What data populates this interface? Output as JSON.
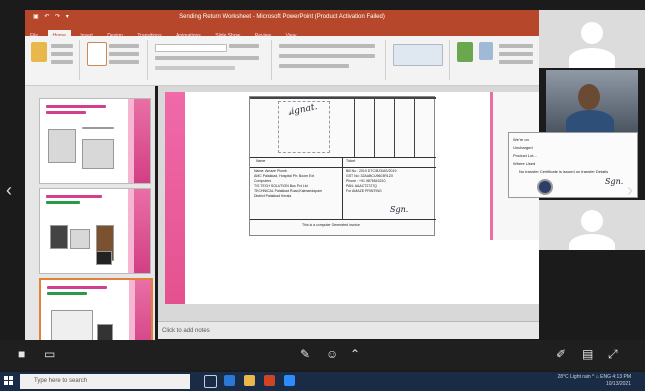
{
  "window": {
    "title": "Sending Return Worksheet - Microsoft PowerPoint (Product Activation Failed)",
    "qat_icons": "▣ ↶ ↷ ▾"
  },
  "ribbon": {
    "tabs": [
      "File",
      "Home",
      "Insert",
      "Design",
      "Transitions",
      "Animations",
      "Slide Show",
      "Review",
      "View"
    ],
    "active_tab": "Home"
  },
  "slide_pane": {
    "thumbnails": [
      {
        "num": "1",
        "selected": false
      },
      {
        "num": "2",
        "selected": false
      },
      {
        "num": "3",
        "selected": true
      }
    ]
  },
  "document": {
    "header_rows": [
      "Name",
      "Ticket"
    ],
    "body_left": "Name: Amaze Plumb\nAMC Palakkad, Hospital Ph: Boom Ext\nComputers\nT/S TECH SOLUTION Bus Pvt Ltd\nTECHNICAL Palakkad Road,Kalmandapam\nDistrict Palakkad Kerala",
    "body_right": "Bill No : 2019 DTC/BJ3/AS/2019\nGST No: 32AABCU9603R1ZX\nPhone : +91 9876543210\nPAN: AAACT2727Q\nFor AMAZE PRINTING",
    "footer": "This is a computer Generated invoice"
  },
  "notes": {
    "placeholder": "Click to add notes"
  },
  "share_panel": {
    "lines": [
      "We're on",
      "Uncharged",
      "Product Lot...",
      "Where Used",
      "No transfer Certificate is issued on transfer Details"
    ]
  },
  "zoom_controls": {
    "icons": [
      "mic-icon",
      "camera-icon",
      "share-icon",
      "pen-icon",
      "chat-icon",
      "expand-icon"
    ]
  },
  "taskbar": {
    "search_placeholder": "Type here to search",
    "tray_time": "4:13 PM",
    "tray_date": "10/13/2021",
    "tray_status": "28°C Light rain ^ ⌂ ENG"
  },
  "colors": {
    "powerpoint_accent": "#b7472a",
    "slide_pink": "#e96fa5",
    "taskbar": "#1a2b45"
  }
}
